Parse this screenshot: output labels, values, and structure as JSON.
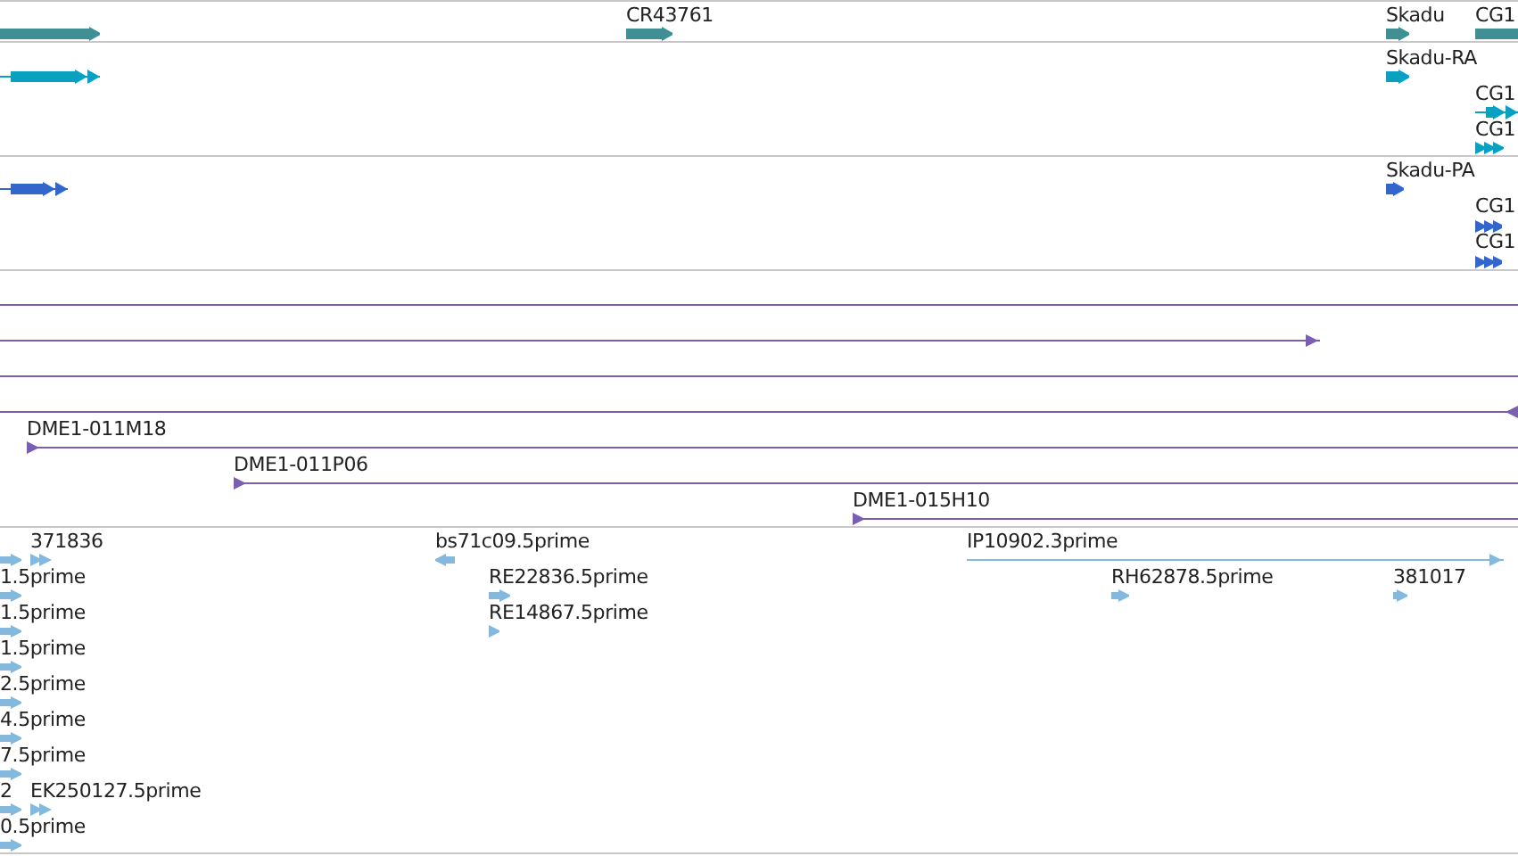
{
  "tracks": [
    {
      "kind": "gene",
      "features": [
        {
          "reverse": false
        },
        {
          "label": "CR43761",
          "reverse": false
        },
        {
          "label": "Skadu",
          "reverse": false
        },
        {
          "label": "CG1",
          "kind": "span"
        }
      ]
    },
    {
      "kind": "transcript",
      "features": [
        {
          "reverse": false
        },
        {
          "label": "Skadu-RA",
          "reverse": false
        },
        {
          "label": "CG1",
          "reverse": false
        },
        {
          "label": "CG1",
          "reverse": false
        }
      ]
    },
    {
      "kind": "protein",
      "features": [
        {
          "reverse": false
        },
        {
          "label": "Skadu-PA",
          "reverse": false
        },
        {
          "label": "CG1",
          "reverse": false
        },
        {
          "label": "CG1",
          "reverse": false
        }
      ]
    },
    {
      "kind": "clone",
      "features": [
        {
          "kind": "span"
        },
        {
          "reverse": false
        },
        {
          "kind": "span"
        },
        {
          "reverse": true
        },
        {
          "label": "DME1-011M18",
          "reverse": false
        },
        {
          "label": "DME1-011P06",
          "reverse": false
        },
        {
          "label": "DME1-015H10",
          "reverse": false
        }
      ]
    },
    {
      "kind": "est",
      "features": [
        {
          "reverse": false
        },
        {
          "label": "371836",
          "reverse": false
        },
        {
          "label": "bs71c09.5prime",
          "reverse": true
        },
        {
          "label": "IP10902.3prime",
          "reverse": false
        },
        {
          "label": "1.5prime",
          "reverse": false
        },
        {
          "label": "RE22836.5prime",
          "reverse": false
        },
        {
          "label": "RH62878.5prime",
          "reverse": false
        },
        {
          "label": "381017",
          "reverse": false
        },
        {
          "label": "1.5prime",
          "reverse": false
        },
        {
          "label": "RE14867.5prime",
          "reverse": false
        },
        {
          "label": "1.5prime",
          "reverse": false
        },
        {
          "label": "2.5prime",
          "reverse": false
        },
        {
          "label": "4.5prime",
          "reverse": false
        },
        {
          "label": "7.5prime",
          "reverse": false
        },
        {
          "label": "2",
          "reverse": false
        },
        {
          "label": "EK250127.5prime",
          "reverse": false
        },
        {
          "label": "0.5prime",
          "reverse": false
        }
      ]
    }
  ]
}
